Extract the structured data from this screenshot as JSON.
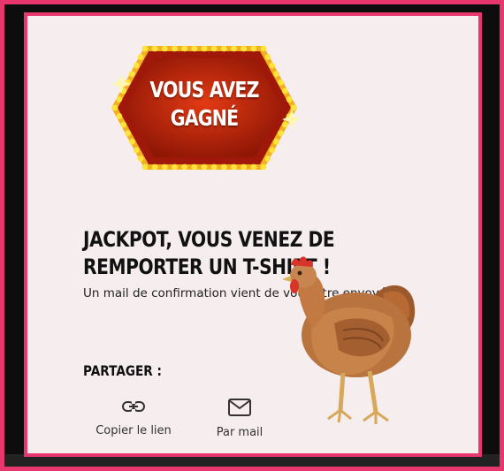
{
  "badge": {
    "line1": "VOUS AVEZ",
    "line2": "GAGNÉ"
  },
  "headline": "JACKPOT, VOUS VENEZ DE REMPORTER UN T-SHIRT !",
  "confirmation": "Un mail de confirmation vient de vous être envoyé.",
  "share": {
    "title": "PARTAGER :",
    "copy_link_label": "Copier le lien",
    "copy_link_icon": "link-icon",
    "mail_label": "Par mail",
    "mail_icon": "mail-icon"
  },
  "colors": {
    "border_pink": "#e8376f",
    "card_bg": "#f6eeee",
    "badge_red": "#c8290f",
    "bulb_yellow": "#ffd21e"
  }
}
